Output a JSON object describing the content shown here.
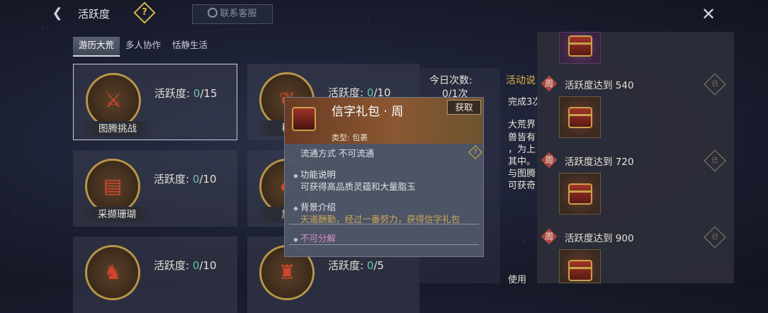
{
  "header": {
    "title": "活跃度",
    "help_glyph": "?",
    "service_label": "联系客服",
    "back_icon": "chevron-left-icon",
    "close_icon": "close-icon"
  },
  "tabs": [
    {
      "label": "游历大荒",
      "active": true
    },
    {
      "label": "多人协作",
      "active": false
    },
    {
      "label": "恬静生活",
      "active": false
    }
  ],
  "activities": [
    {
      "name": "图腾挑战",
      "label": "活跃度: ",
      "current": "0",
      "total": "/15",
      "glyph": "⚔",
      "selected": true
    },
    {
      "name": "秘境",
      "label": "活跃度: ",
      "current": "0",
      "total": "/10",
      "glyph": "❦"
    },
    {
      "name": "采撷珊瑚",
      "label": "活跃度: ",
      "current": "0",
      "total": "/10",
      "glyph": "▤"
    },
    {
      "name": "旅行",
      "label": "",
      "current": "",
      "total": "",
      "glyph": "♠"
    },
    {
      "name": "",
      "label": "活跃度: ",
      "current": "0",
      "total": "/10",
      "glyph": "♞"
    },
    {
      "name": "",
      "label": "活跃度: ",
      "current": "0",
      "total": "/5",
      "glyph": "♜"
    }
  ],
  "today": {
    "label": "今日次数:",
    "value": "0/1次"
  },
  "description": {
    "title": "活动说",
    "lines": [
      "完成3次",
      "大荒界",
      "兽皆有",
      "，为上",
      "其中。",
      "与图腾",
      "可获奇",
      "使用"
    ]
  },
  "rewards": [
    {
      "tag": "周",
      "label": "活跃度达到 540",
      "badge": "已"
    },
    {
      "tag": "周",
      "label": "活跃度达到 720",
      "badge": "已"
    },
    {
      "tag": "周",
      "label": "活跃度达到 900",
      "badge": "已"
    }
  ],
  "tooltip": {
    "name": "信字礼包 · 周",
    "action": "获取",
    "type": "类型: 包裹",
    "circulation": "流通方式   不可流通",
    "help_glyph": "?",
    "function_title": "功能说明",
    "function_text": "可获得高品质灵蕴和大量脂玉",
    "background_title": "背景介绍",
    "background_text": "天道酬勤，经过一番努力，获得信字礼包",
    "decompose": "不可分解",
    "bullet": "◆"
  },
  "colors": {
    "accent_gold": "#d9b44a",
    "current_value": "#67c1b4",
    "zhou_badge": "#a9473d"
  }
}
